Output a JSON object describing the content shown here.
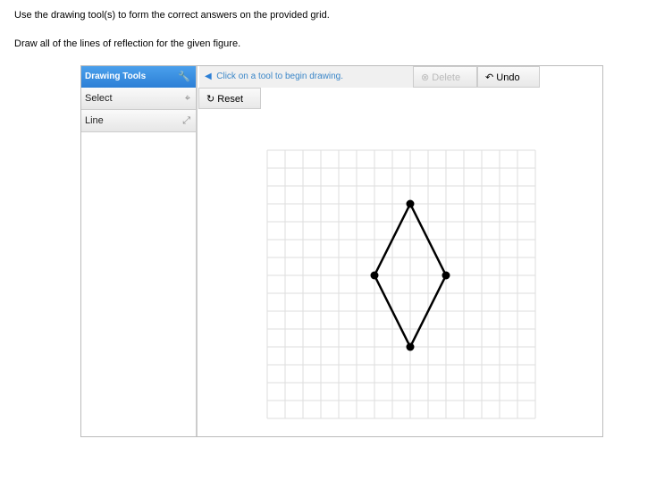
{
  "instructions": [
    "Use the drawing tool(s) to form the correct answers on the provided grid.",
    "Draw all of the lines of reflection for the given figure."
  ],
  "toolbar": {
    "header": "Drawing Tools",
    "tools": [
      {
        "label": "Select",
        "icon": "select-cursor-icon"
      },
      {
        "label": "Line",
        "icon": "line-arrows-icon"
      }
    ],
    "status": "Click on a tool to begin drawing.",
    "delete_label": "Delete",
    "undo_label": "Undo",
    "reset_label": "Reset"
  },
  "grid": {
    "columns": 15,
    "rows": 15,
    "figure": "rhombus",
    "vertices": [
      [
        8,
        3
      ],
      [
        10,
        7
      ],
      [
        8,
        11
      ],
      [
        6,
        7
      ]
    ],
    "line_color": "#000000",
    "grid_color": "#dddddd"
  },
  "help": "?",
  "colors": {
    "accent": "#2c7fd6",
    "status_text": "#3a86c8"
  }
}
